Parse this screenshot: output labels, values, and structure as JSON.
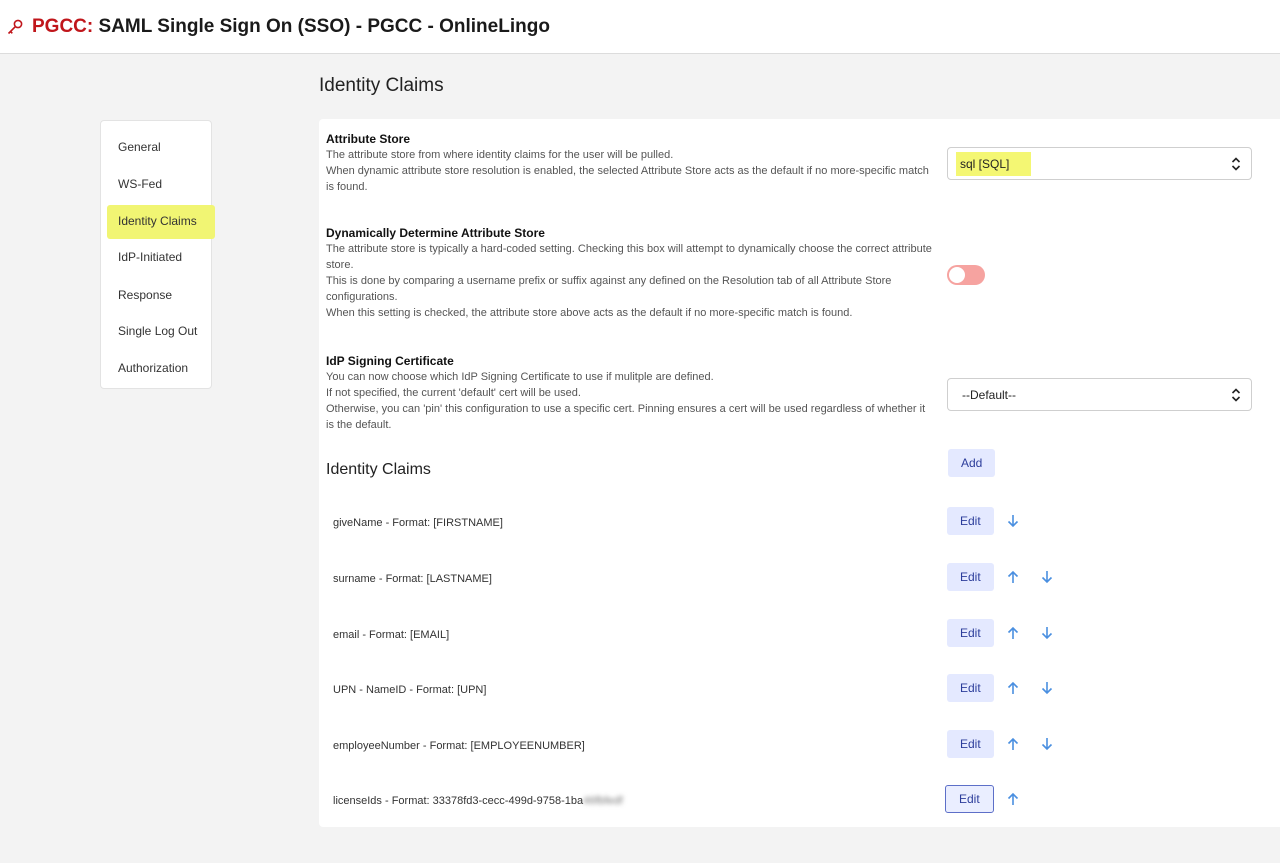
{
  "header": {
    "icon": "key-icon",
    "org": "PGCC:",
    "title": "SAML Single Sign On (SSO) - PGCC - OnlineLingo"
  },
  "page_title": "Identity Claims",
  "sidebar": {
    "items": [
      {
        "label": "General"
      },
      {
        "label": "WS-Fed"
      },
      {
        "label": "Identity Claims",
        "active": true
      },
      {
        "label": "IdP-Initiated"
      },
      {
        "label": "Response"
      },
      {
        "label": "Single Log Out"
      },
      {
        "label": "Authorization"
      }
    ]
  },
  "attribute_store": {
    "label": "Attribute Store",
    "desc": [
      "The attribute store from where identity claims for the user will be pulled.",
      "When dynamic attribute store resolution is enabled, the selected Attribute Store acts as the default if no more-specific match is found."
    ],
    "value": "sql [SQL]"
  },
  "dynamic_store": {
    "label": "Dynamically Determine Attribute Store",
    "desc": [
      "The attribute store is typically a hard-coded setting. Checking this box will attempt to dynamically choose the correct attribute store.",
      "This is done by comparing a username prefix or suffix against any defined on the Resolution tab of all Attribute Store configurations.",
      "When this setting is checked, the attribute store above acts as the default if no more-specific match is found."
    ],
    "enabled": false
  },
  "signing_cert": {
    "label": "IdP Signing Certificate",
    "desc": [
      "You can now choose which IdP Signing Certificate to use if mulitple are defined.",
      "If not specified, the current 'default' cert will be used.",
      "Otherwise, you can 'pin' this configuration to use a specific cert. Pinning ensures a cert will be used regardless of whether it is the default."
    ],
    "value": "--Default--"
  },
  "claims": {
    "title": "Identity Claims",
    "add_label": "Add",
    "edit_label": "Edit",
    "items": [
      {
        "text": "giveName - Format: [FIRSTNAME]",
        "up": false,
        "down": true
      },
      {
        "text": "surname - Format: [LASTNAME]",
        "up": true,
        "down": true
      },
      {
        "text": "email - Format: [EMAIL]",
        "up": true,
        "down": true
      },
      {
        "text": "UPN - NameID - Format: [UPN]",
        "up": true,
        "down": true
      },
      {
        "text": "employeeNumber - Format: [EMPLOYEENUMBER]",
        "up": true,
        "down": true
      },
      {
        "text": "licenseIds - Format: 33378fd3-cecc-499d-9758-1ba",
        "blurred_suffix": "46fbfedf",
        "up": true,
        "down": false
      }
    ]
  },
  "colors": {
    "accent": "#2c3d9b",
    "button_bg": "#e4e9ff",
    "highlight": "#f1f573",
    "org_red": "#c0161b",
    "toggle_off": "#f6a3a0",
    "arrow_blue": "#4a8fe0"
  }
}
